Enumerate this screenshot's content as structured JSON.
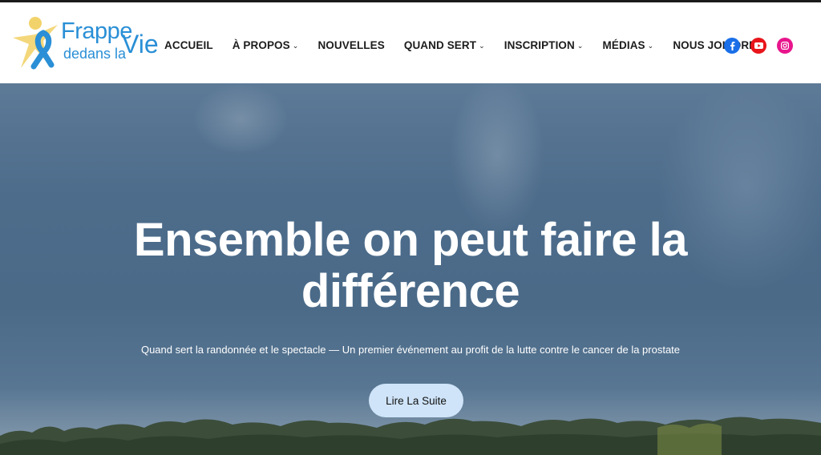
{
  "header": {
    "logo": {
      "line1": "Frappe",
      "line2": "dedans la",
      "line3": "Vie"
    },
    "nav": [
      {
        "label": "ACCUEIL",
        "has_dropdown": false
      },
      {
        "label": "À PROPOS",
        "has_dropdown": true
      },
      {
        "label": "NOUVELLES",
        "has_dropdown": false
      },
      {
        "label": "QUAND SERT",
        "has_dropdown": true
      },
      {
        "label": "INSCRIPTION",
        "has_dropdown": true
      },
      {
        "label": "MÉDIAS",
        "has_dropdown": true
      },
      {
        "label": "NOUS JOINDRE",
        "has_dropdown": true
      }
    ],
    "dropdown_glyph": "⌄",
    "socials": [
      {
        "icon": "facebook-icon",
        "color": "#1a6fe8"
      },
      {
        "icon": "youtube-icon",
        "color": "#e8151b"
      },
      {
        "icon": "instagram-icon",
        "color": "#e8158c"
      }
    ]
  },
  "hero": {
    "title": "Ensemble on peut faire la différence",
    "subtitle": "Quand sert la randonnée et le spectacle — Un premier événement au profit de la lutte contre le cancer de la prostate",
    "cta_label": "Lire La Suite"
  },
  "colors": {
    "brand_blue": "#2a8fd6",
    "logo_yellow": "#f2d36b",
    "cta_bg": "#cfe4f8"
  }
}
